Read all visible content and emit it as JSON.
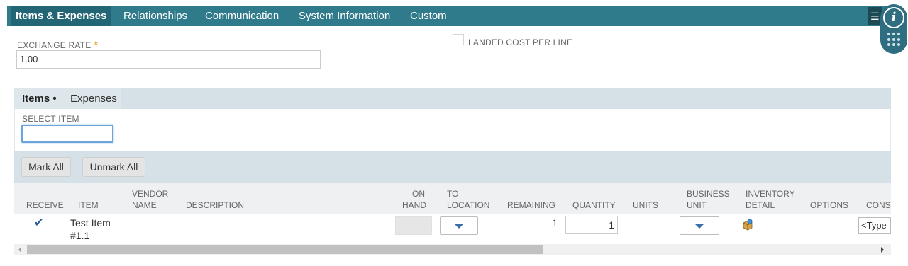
{
  "tabs": [
    {
      "label": "Items & Expenses",
      "active": true
    },
    {
      "label": "Relationships",
      "active": false
    },
    {
      "label": "Communication",
      "active": false
    },
    {
      "label": "System Information",
      "active": false
    },
    {
      "label": "Custom",
      "active": false
    }
  ],
  "tab_menu_icon": "list-menu-icon",
  "info_icon_glyph": "i",
  "header_fields": {
    "exchange_rate_label": "EXCHANGE RATE",
    "required_marker": "*",
    "exchange_rate_value": "1.00",
    "landed_cost_label": "LANDED COST PER LINE",
    "landed_cost_checked": false
  },
  "subtabs": [
    {
      "label": "Items •",
      "active": true
    },
    {
      "label": "Expenses",
      "active": false
    }
  ],
  "select_item": {
    "label": "SELECT ITEM",
    "value": ""
  },
  "buttons": {
    "mark_all": "Mark All",
    "unmark_all": "Unmark All"
  },
  "columns": [
    "RECEIVE",
    "ITEM",
    "VENDOR\nNAME",
    "DESCRIPTION",
    "ON\nHAND",
    "TO\nLOCATION",
    "REMAINING",
    "QUANTITY",
    "UNITS",
    "BUSINESS\nUNIT",
    "INVENTORY\nDETAIL",
    "OPTIONS",
    "CONST"
  ],
  "row": {
    "receive_checked": true,
    "check_glyph": "✔",
    "item": "Test Item\n#1.1",
    "remaining": "1",
    "quantity": "1",
    "type_field": "<Type"
  },
  "colors": {
    "tab_bar": "#2f7b8c",
    "accent_required": "#e8a21a",
    "sublist_bg": "#d5e1e6"
  }
}
